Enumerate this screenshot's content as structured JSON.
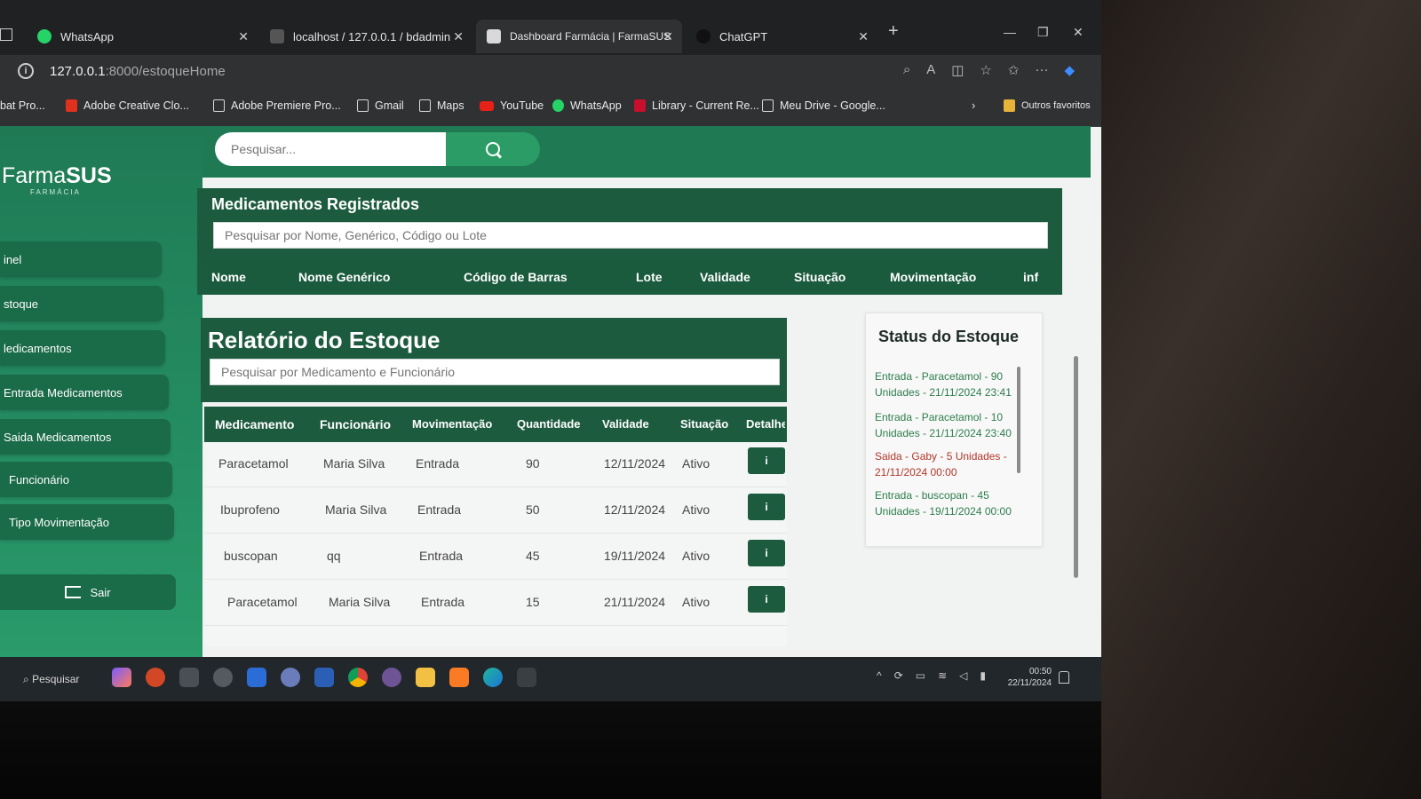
{
  "browser": {
    "tabs": [
      {
        "label": "WhatsApp",
        "active": false,
        "color": "#25d366"
      },
      {
        "label": "localhost / 127.0.0.1 / bdadmin",
        "active": false,
        "color": "#6c6c6c"
      },
      {
        "label": "Dashboard Farmácia | FarmaSUS",
        "active": true,
        "color": "#d9d9d9"
      },
      {
        "label": "ChatGPT",
        "active": false,
        "color": "#1f1f1f"
      }
    ],
    "url_host": "127.0.0.1",
    "url_path": ":8000/estoqueHome",
    "bookmarks": [
      {
        "label": "bat Pro...",
        "icon": "pdf-icon"
      },
      {
        "label": "Adobe Creative Clo...",
        "icon": "adobe-icon"
      },
      {
        "label": "Adobe Premiere Pro...",
        "icon": "doc-icon"
      },
      {
        "label": "Gmail",
        "icon": "doc-icon"
      },
      {
        "label": "Maps",
        "icon": "doc-icon"
      },
      {
        "label": "YouTube",
        "icon": "youtube-icon"
      },
      {
        "label": "WhatsApp",
        "icon": "whatsapp-icon"
      },
      {
        "label": "Library - Current Re...",
        "icon": "library-icon"
      },
      {
        "label": "Meu Drive - Google...",
        "icon": "doc-icon"
      }
    ],
    "other_favorites": "Outros favoritos"
  },
  "app": {
    "logo_light": "Farma",
    "logo_bold": "SUS",
    "logo_sub": "FARMÁCIA",
    "search_placeholder": "Pesquisar...",
    "nav": [
      "inel",
      "stoque",
      "ledicamentos",
      "Entrada Medicamentos",
      "Saida Medicamentos",
      "Funcionário",
      "Tipo Movimentação"
    ],
    "logout": "Sair",
    "accent": "#1d5b3f"
  },
  "medicamentos": {
    "title": "Medicamentos Registrados",
    "search_placeholder": "Pesquisar por Nome, Genérico, Código ou Lote",
    "columns": [
      "Nome",
      "Nome Genérico",
      "Código de Barras",
      "Lote",
      "Validade",
      "Situação",
      "Movimentação",
      "inf"
    ]
  },
  "relatorio": {
    "title": "Relatório do Estoque",
    "search_placeholder": "Pesquisar por Medicamento e Funcionário",
    "columns": [
      "Medicamento",
      "Funcionário",
      "Movimentação",
      "Quantidade",
      "Validade",
      "Situação",
      "Detalhe"
    ],
    "rows": [
      [
        "Paracetamol",
        "Maria Silva",
        "Entrada",
        "90",
        "12/11/2024",
        "Ativo"
      ],
      [
        "Ibuprofeno",
        "Maria Silva",
        "Entrada",
        "50",
        "12/11/2024",
        "Ativo"
      ],
      [
        "buscopan",
        "qq",
        "Entrada",
        "45",
        "19/11/2024",
        "Ativo"
      ],
      [
        "Paracetamol",
        "Maria Silva",
        "Entrada",
        "15",
        "21/11/2024",
        "Ativo"
      ]
    ],
    "detail_button": "i"
  },
  "status": {
    "title": "Status do Estoque",
    "items": [
      {
        "text": "Entrada - Paracetamol - 90 Unidades - 21/11/2024 23:41",
        "color": "#2e7d4f"
      },
      {
        "text": "Entrada - Paracetamol - 10 Unidades - 21/11/2024 23:40",
        "color": "#2e7d4f"
      },
      {
        "text": "Saida - Gaby - 5 Unidades - 21/11/2024 00:00",
        "color": "#b3352b"
      },
      {
        "text": "Entrada - buscopan - 45 Unidades - 19/11/2024 00:00",
        "color": "#2e7d4f"
      }
    ]
  },
  "taskbar": {
    "search_label": "Pesquisar",
    "time": "00:50",
    "date": "22/11/2024"
  }
}
